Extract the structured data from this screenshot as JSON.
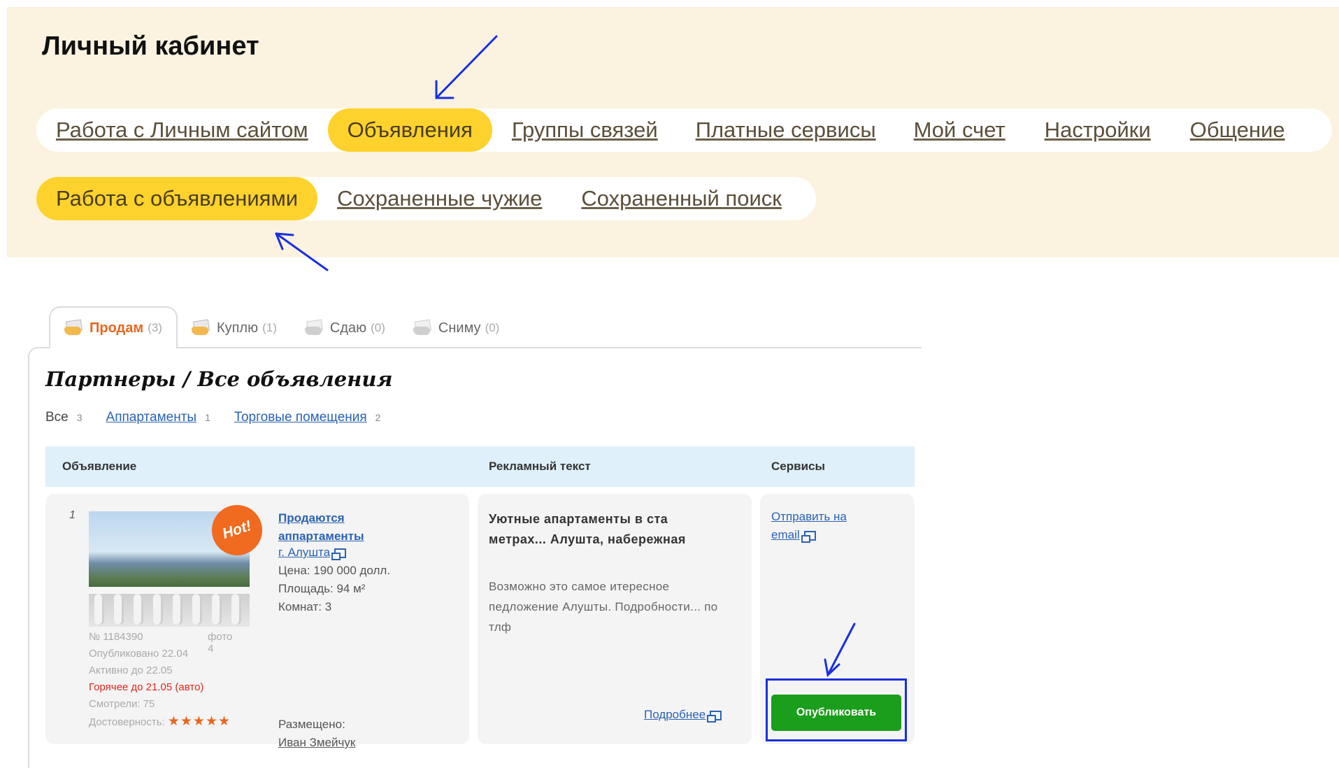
{
  "page": {
    "title": "Личный кабинет"
  },
  "main_nav": [
    {
      "label": "Работа с Личным сайтом",
      "active": false
    },
    {
      "label": "Объявления",
      "active": true
    },
    {
      "label": "Группы связей",
      "active": false
    },
    {
      "label": "Платные сервисы",
      "active": false
    },
    {
      "label": "Мой счет",
      "active": false
    },
    {
      "label": "Настройки",
      "active": false
    },
    {
      "label": "Общение",
      "active": false
    }
  ],
  "sub_nav": [
    {
      "label": "Работа с объявлениями",
      "active": true
    },
    {
      "label": "Сохраненные чужие",
      "active": false
    },
    {
      "label": "Сохраненный поиск",
      "active": false
    }
  ],
  "tabs": [
    {
      "label": "Продам",
      "count": "(3)",
      "active": true
    },
    {
      "label": "Куплю",
      "count": "(1)",
      "active": false
    },
    {
      "label": "Сдаю",
      "count": "(0)",
      "active": false
    },
    {
      "label": "Сниму",
      "count": "(0)",
      "active": false
    }
  ],
  "section": {
    "title": "Партнеры / Все объявления"
  },
  "filters": [
    {
      "label": "Все",
      "count": "3",
      "link": false
    },
    {
      "label": "Аппартаменты",
      "count": "1",
      "link": true
    },
    {
      "label": "Торговые помещения",
      "count": "2",
      "link": true
    }
  ],
  "table": {
    "columns": [
      "Объявление",
      "Рекламный текст",
      "Сервисы"
    ]
  },
  "listing": {
    "num": "1",
    "hot_badge": "Hot!",
    "id": "№ 1184390",
    "photo_label": "фото 4",
    "published": "Опубликовано 22.04",
    "active_until": "Активно до 22.05",
    "hot_until": "Горячее до 21.05 (авто)",
    "views": "Смотрели: 75",
    "reliability_label": "Достоверность:",
    "rating_stars": "★★★★★",
    "title": "Продаются аппартаменты",
    "city": "г. Алушта",
    "price": "Цена: 190 000 долл.",
    "area": "Площадь: 94 м²",
    "rooms": "Комнат: 3",
    "placed_label": "Размещено:",
    "owner": "Иван Змейчук",
    "promo_headline": "Уютные апартаменты в ста метрах... Алушта, набережная",
    "promo_text": "Возможно это самое итересное пeдложение Алушты. Подробности... по тлф",
    "more_link": "Подробнее",
    "send_email": "Отправить на email",
    "publish_button": "Опубликовать"
  },
  "colors": {
    "panel_bg": "#fbf3e0",
    "active_pill": "#fdd22c",
    "link_blue": "#2a62b4",
    "table_header_bg": "#dff0fb",
    "publish_green": "#1b9e1b",
    "annotation_blue": "#1a2fe0",
    "hot_orange": "#f06a1f"
  }
}
